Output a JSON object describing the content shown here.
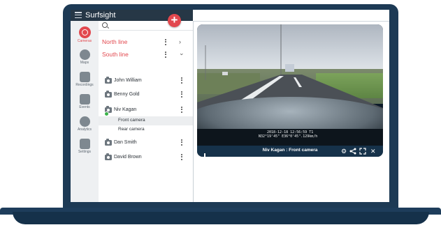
{
  "app": {
    "title": "Surfsight",
    "add_label": "+"
  },
  "nav": {
    "items": [
      {
        "label": "Cameras",
        "icon": "camera-icon",
        "active": true
      },
      {
        "label": "Maps",
        "icon": "map-pin-icon"
      },
      {
        "label": "Recordings",
        "icon": "video-icon"
      },
      {
        "label": "Events",
        "icon": "calendar-icon"
      },
      {
        "label": "Analytics",
        "icon": "chart-icon"
      },
      {
        "label": "Settings",
        "icon": "gear-icon"
      }
    ]
  },
  "panel": {
    "groups": [
      {
        "label": "North line",
        "expand": "›"
      },
      {
        "label": "South line",
        "expand": "⌄"
      }
    ],
    "vehicles": [
      {
        "label": "John William"
      },
      {
        "label": "Benny Gold"
      },
      {
        "label": "Niv Kagan",
        "online": true,
        "cameras": [
          "Front camera",
          "Rear camera"
        ]
      },
      {
        "label": "Dan Smith"
      },
      {
        "label": "David Brown"
      }
    ]
  },
  "player": {
    "title": "Niv Kagan : Front camera",
    "timestamp_line1": "2018-12-18 12:56:59 T1",
    "timestamp_line2": "N32°19'45\" E36°0'45\".129km/h",
    "colors": {
      "controls_bg": "#16324a",
      "accent": "#e2484e"
    }
  }
}
